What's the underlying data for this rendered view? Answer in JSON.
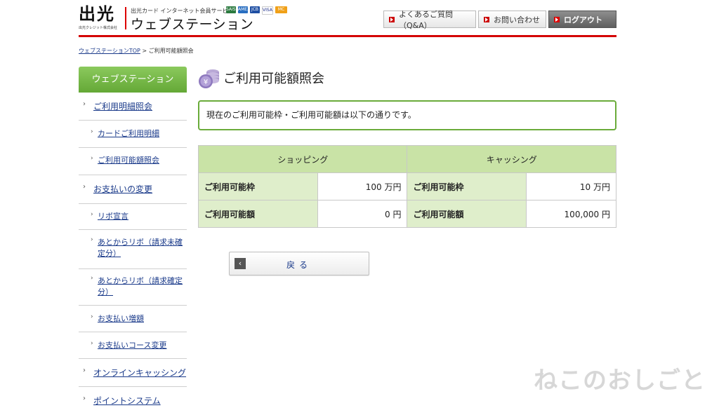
{
  "header": {
    "logo_text": "出光",
    "logo_sub": "出光クレジット株式会社",
    "service_text": "出光カード インターネット会員サービス",
    "brand_title": "ウェブステーション",
    "cards": [
      "SAISON",
      "AMEX",
      "JCB",
      "VISA",
      "MC"
    ],
    "buttons": {
      "faq": "よくあるご質問（Q&A）",
      "contact": "お問い合わせ",
      "logout": "ログアウト"
    },
    "accent": "#d40000"
  },
  "breadcrumb": {
    "home": "ウェブステーションTOP",
    "separator": ">",
    "current": "ご利用可能額照会"
  },
  "sidebar": {
    "title": "ウェブステーション",
    "items": [
      {
        "label": "ご利用明細照会",
        "level": "main"
      },
      {
        "label": "カードご利用明細",
        "level": "sub"
      },
      {
        "label": "ご利用可能額照会",
        "level": "sub"
      },
      {
        "label": "お支払いの変更",
        "level": "main"
      },
      {
        "label": "リボ宣言",
        "level": "sub"
      },
      {
        "label": "あとからリボ（請求未確定分）",
        "level": "sub"
      },
      {
        "label": "あとからリボ（請求確定分）",
        "level": "sub"
      },
      {
        "label": "お支払い増額",
        "level": "sub"
      },
      {
        "label": "お支払いコース変更",
        "level": "sub"
      },
      {
        "label": "オンラインキャッシング",
        "level": "main"
      },
      {
        "label": "ポイントシステム",
        "level": "main"
      }
    ]
  },
  "main": {
    "title": "ご利用可能額照会",
    "notice": "現在のご利用可能枠・ご利用可能額は以下の通りです。",
    "table": {
      "headers": [
        "ショッピング",
        "キャッシング"
      ],
      "rows": [
        {
          "shop_label": "ご利用可能枠",
          "shop_value": "100 万円",
          "cash_label": "ご利用可能枠",
          "cash_value": "10 万円"
        },
        {
          "shop_label": "ご利用可能額",
          "shop_value": "0 円",
          "cash_label": "ご利用可能額",
          "cash_value": "100,000 円"
        }
      ]
    },
    "back_label": "戻る"
  },
  "watermark": "ねこのおしごと"
}
